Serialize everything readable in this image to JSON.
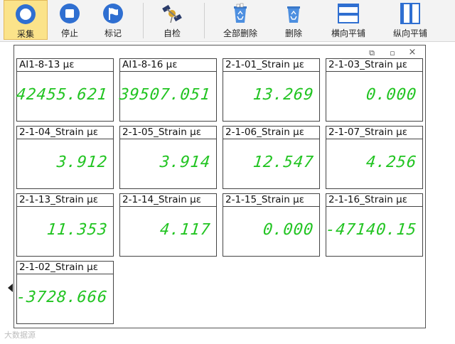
{
  "toolbar": {
    "buttons": [
      {
        "label": "采集",
        "icon": "record-circle-icon",
        "active": true
      },
      {
        "label": "停止",
        "icon": "stop-icon",
        "active": false
      },
      {
        "label": "标记",
        "icon": "flag-icon",
        "active": false
      },
      {
        "label": "自检",
        "icon": "satellite-icon",
        "active": false
      },
      {
        "label": "全部删除",
        "icon": "recycle-bin-full-icon",
        "active": false
      },
      {
        "label": "删除",
        "icon": "recycle-bin-icon",
        "active": false
      },
      {
        "label": "横向平铺",
        "icon": "tile-horizontal-icon",
        "active": false
      },
      {
        "label": "纵向平铺",
        "icon": "tile-vertical-icon",
        "active": false
      }
    ]
  },
  "window": {
    "restore_glyph": "⧉",
    "minimize_glyph": "▫",
    "close_glyph": "×"
  },
  "tiles": [
    {
      "title": "AI1-8-13  με",
      "value": "42455.621"
    },
    {
      "title": "AI1-8-16  με",
      "value": "39507.051"
    },
    {
      "title": "2-1-01_Strain  με",
      "value": "13.269"
    },
    {
      "title": "2-1-03_Strain  με",
      "value": "0.000"
    },
    {
      "title": "2-1-04_Strain  με",
      "value": "3.912"
    },
    {
      "title": "2-1-05_Strain  με",
      "value": "3.914"
    },
    {
      "title": "2-1-06_Strain  με",
      "value": "12.547"
    },
    {
      "title": "2-1-07_Strain  με",
      "value": "4.256"
    },
    {
      "title": "2-1-13_Strain  με",
      "value": "11.353"
    },
    {
      "title": "2-1-14_Strain  με",
      "value": "4.117"
    },
    {
      "title": "2-1-15_Strain  με",
      "value": "0.000"
    },
    {
      "title": "2-1-16_Strain  με",
      "value": "-47140.15"
    },
    {
      "title": "2-1-02_Strain  με",
      "value": "-3728.666"
    }
  ],
  "watermark": "大数据源"
}
